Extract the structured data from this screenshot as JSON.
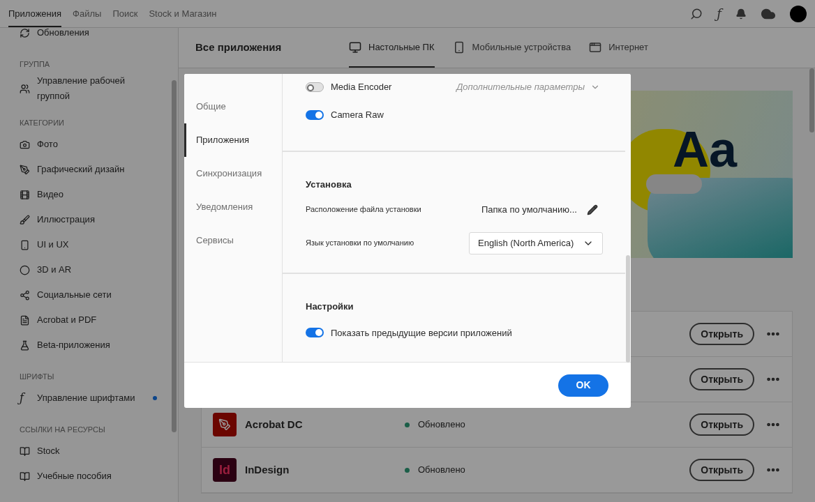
{
  "top_nav": {
    "font_button": "ƒ",
    "tabs": [
      {
        "label": "Приложения",
        "selected": true
      },
      {
        "label": "Файлы",
        "selected": false
      },
      {
        "label": "Поиск",
        "selected": false
      },
      {
        "label": "Stock и Магазин",
        "selected": false
      }
    ]
  },
  "sidebar": {
    "sections": [
      {
        "items": [
          {
            "label": "Обновления",
            "dot": false
          }
        ]
      },
      {
        "heading": "ГРУППА",
        "items": [
          {
            "label": "Управление рабочей группой",
            "dot": false
          }
        ]
      },
      {
        "heading": "КАТЕГОРИИ",
        "items": [
          {
            "label": "Фото",
            "dot": false
          },
          {
            "label": "Графический дизайн",
            "dot": false
          },
          {
            "label": "Видео",
            "dot": false
          },
          {
            "label": "Иллюстрация",
            "dot": false
          },
          {
            "label": "UI и UX",
            "dot": false
          },
          {
            "label": "3D и AR",
            "dot": false
          },
          {
            "label": "Социальные сети",
            "dot": false
          },
          {
            "label": "Acrobat и PDF",
            "dot": false
          },
          {
            "label": "Beta-приложения",
            "dot": false
          }
        ]
      },
      {
        "heading": "ШРИФТЫ",
        "items": [
          {
            "label": "Управление шрифтами",
            "glyph": "ƒ",
            "dot": true
          }
        ]
      },
      {
        "heading": "ССЫЛКИ НА РЕСУРСЫ",
        "items": [
          {
            "label": "Stock",
            "dot": false
          },
          {
            "label": "Учебные пособия",
            "dot": false
          }
        ]
      }
    ]
  },
  "main": {
    "title": "Все приложения",
    "tabs": [
      {
        "label": "Настольные ПК",
        "selected": true
      },
      {
        "label": "Мобильные устройства",
        "selected": false
      },
      {
        "label": "Интернет",
        "selected": false
      }
    ],
    "banner": {
      "text": "Aa"
    },
    "apps": [
      {
        "button": "Открыть"
      },
      {
        "button": "Открыть"
      },
      {
        "name": "Acrobat DC",
        "kind": "acrobat",
        "status": "Обновлено",
        "button": "Открыть"
      },
      {
        "name": "InDesign",
        "logo": "Id",
        "kind": "indesign",
        "status": "Обновлено",
        "button": "Открыть"
      }
    ]
  },
  "dialog": {
    "nav": [
      {
        "label": "Общие",
        "selected": false
      },
      {
        "label": "Приложения",
        "selected": true
      },
      {
        "label": "Синхронизация",
        "selected": false
      },
      {
        "label": "Уведомления",
        "selected": false
      },
      {
        "label": "Сервисы",
        "selected": false
      }
    ],
    "app_toggles": [
      {
        "label": "Media Encoder",
        "on": false
      },
      {
        "label": "Camera Raw",
        "on": true
      }
    ],
    "advanced": "Дополнительные параметры",
    "install": {
      "heading": "Установка",
      "location_label": "Расположение файла установки",
      "location_value": "Папка по умолчанию...",
      "language_label": "Язык установки по умолчанию",
      "language_value": "English (North America)"
    },
    "settings": {
      "heading": "Настройки",
      "toggle": {
        "label": "Показать предыдущие версии приложений",
        "on": true
      }
    },
    "ok": "OK"
  }
}
